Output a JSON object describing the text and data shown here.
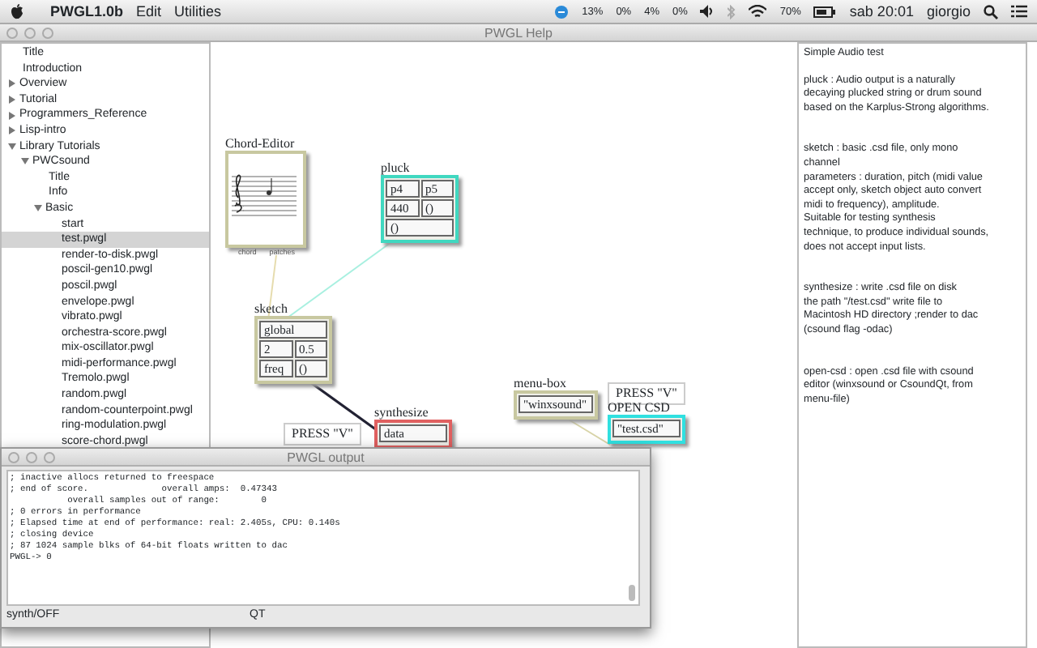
{
  "menubar": {
    "app": "PWGL1.0b",
    "menus": [
      "Edit",
      "Utilities"
    ],
    "meters": [
      "13%",
      "0%",
      "4%",
      "0%"
    ],
    "battery": "70%",
    "clock": "sab 20:01",
    "user": "giorgio"
  },
  "window": {
    "title": "PWGL Help"
  },
  "tree": [
    {
      "label": "Title",
      "selected": false
    },
    {
      "label": "Introduction",
      "selected": false
    },
    {
      "label": "Overview",
      "selected": false,
      "expanded": false
    },
    {
      "label": "Tutorial",
      "selected": false,
      "expanded": false
    },
    {
      "label": "Programmers_Reference",
      "selected": false,
      "expanded": false
    },
    {
      "label": "Lisp-intro",
      "selected": false,
      "expanded": false
    },
    {
      "label": "Library Tutorials",
      "selected": false,
      "expanded": true,
      "children": [
        {
          "label": "PWCsound",
          "selected": false,
          "expanded": true,
          "children": [
            {
              "label": "Title",
              "selected": false
            },
            {
              "label": "Info",
              "selected": false
            },
            {
              "label": "Basic",
              "selected": false,
              "expanded": true,
              "children": [
                {
                  "label": "start",
                  "selected": false
                },
                {
                  "label": "test.pwgl",
                  "selected": true
                },
                {
                  "label": "render-to-disk.pwgl",
                  "selected": false
                },
                {
                  "label": "poscil-gen10.pwgl",
                  "selected": false
                },
                {
                  "label": "poscil.pwgl",
                  "selected": false
                },
                {
                  "label": "envelope.pwgl",
                  "selected": false
                },
                {
                  "label": "vibrato.pwgl",
                  "selected": false
                },
                {
                  "label": "orchestra-score.pwgl",
                  "selected": false
                },
                {
                  "label": "mix-oscillator.pwgl",
                  "selected": false
                },
                {
                  "label": "midi-performance.pwgl",
                  "selected": false
                },
                {
                  "label": "Tremolo.pwgl",
                  "selected": false
                },
                {
                  "label": "random.pwgl",
                  "selected": false
                },
                {
                  "label": "random-counterpoint.pwgl",
                  "selected": false
                },
                {
                  "label": "ring-modulation.pwgl",
                  "selected": false
                },
                {
                  "label": "score-chord.pwgl",
                  "selected": false
                }
              ]
            }
          ]
        }
      ]
    }
  ],
  "canvas": {
    "boxes": [
      {
        "kind": "chord",
        "title": "Chord-Editor",
        "outputs": [
          "chord",
          "patches"
        ],
        "color": "#c8c8a0"
      },
      {
        "kind": "patch",
        "title": "pluck",
        "rows": [
          [
            "p4",
            "p5"
          ],
          [
            "440",
            "()"
          ],
          [
            "()"
          ]
        ],
        "color": "#40d8c0"
      },
      {
        "kind": "patch",
        "title": "sketch",
        "rows": [
          [
            "global"
          ],
          [
            "2",
            "0.5"
          ],
          [
            "freq",
            "()"
          ]
        ],
        "color": "#c8c8a0"
      },
      {
        "kind": "label",
        "text": "PRESS \"V\""
      },
      {
        "kind": "patch",
        "title": "synthesize",
        "rows": [
          [
            "data"
          ]
        ],
        "color": "#e06060"
      },
      {
        "kind": "patch",
        "title": "menu-box",
        "rows": [
          [
            "\"winxsound\""
          ]
        ],
        "color": "#c8c8a0"
      },
      {
        "kind": "label",
        "text": "PRESS \"V\""
      },
      {
        "kind": "patch",
        "title": "OPEN CSD",
        "rows": [
          [
            "\"test.csd\""
          ]
        ],
        "color": "#30e0e0"
      }
    ]
  },
  "help": {
    "title": "Simple Audio test",
    "paragraphs": [
      [
        "pluck : Audio output is a naturally",
        "decaying plucked string or drum sound",
        "based on the Karplus-Strong algorithms."
      ],
      [
        "sketch : basic .csd file, only mono",
        "channel",
        "parameters : duration, pitch (midi value",
        "accept only, sketch object auto convert",
        "midi to frequency), amplitude.",
        "Suitable for testing synthesis",
        "technique, to produce individual sounds,",
        "does not accept input lists."
      ],
      [
        "synthesize : write .csd file on disk",
        "the path \"/test.csd\" write file to",
        "Macintosh HD directory ;render to dac",
        "(csound flag -odac)"
      ],
      [
        "open-csd : open .csd file with csound",
        "editor (winxsound or CsoundQt, from",
        "menu-file)"
      ]
    ]
  },
  "output": {
    "title": "PWGL output",
    "lines": [
      "; inactive allocs returned to freespace",
      "; end of score.              overall amps:  0.47343",
      "           overall samples out of range:        0",
      "; 0 errors in performance",
      "; Elapsed time at end of performance: real: 2.405s, CPU: 0.140s",
      "; closing device",
      "; 87 1024 sample blks of 64-bit floats written to dac",
      "PWGL-> 0"
    ],
    "status": "synth/OFF",
    "mode": "QT"
  }
}
